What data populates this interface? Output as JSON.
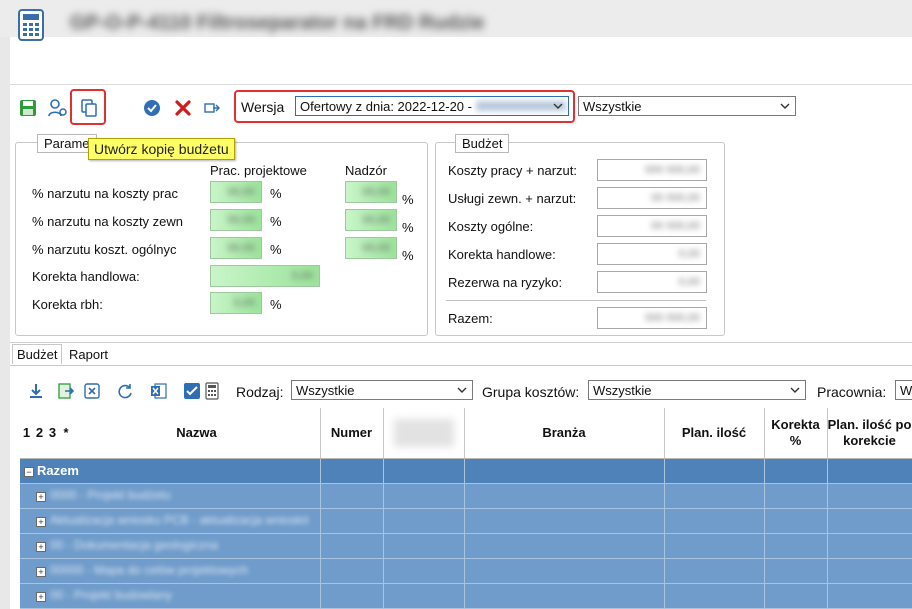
{
  "window": {
    "title": "GP-O-P-4110 Filtroseparator na FRD Rudzie"
  },
  "toolbar": {
    "version_label": "Wersja",
    "version_value": "Ofertowy z dnia: 2022-12-20 -",
    "scope_value": "Wszystkie",
    "tooltip": "Utwórz kopię budżetu"
  },
  "params": {
    "title": "Parame",
    "col_prac": "Prac. projektowe",
    "col_nadzor": "Nadzór",
    "rows": [
      {
        "label": "% narzutu na koszty prac",
        "v1": "00,00",
        "v2": "00,00",
        "pct": "%"
      },
      {
        "label": "% narzutu na koszty zewn",
        "v1": "00,00",
        "v2": "00,00",
        "pct": "%"
      },
      {
        "label": "% narzutu koszt. ogólnyc",
        "v1": "00,00",
        "v2": "00,00",
        "pct": "%"
      }
    ],
    "korekta_handlowa": "Korekta handlowa:",
    "korekta_handlowa_val": "0,00",
    "korekta_rbh": "Korekta rbh:",
    "korekta_rbh_val": "0,00",
    "pct": "%"
  },
  "budzet": {
    "title": "Budżet",
    "rows": [
      {
        "label": "Koszty pracy + narzut:",
        "value": "000 000,00"
      },
      {
        "label": "Usługi zewn. + narzut:",
        "value": "00 000,00"
      },
      {
        "label": "Koszty ogólne:",
        "value": "00 000,00"
      },
      {
        "label": "Korekta handlowe:",
        "value": "0,00"
      },
      {
        "label": "Rezerwa na ryzyko:",
        "value": "0,00"
      }
    ],
    "total_label": "Razem:",
    "total_value": "000 000,00"
  },
  "tabs": [
    "Budżet",
    "Raport"
  ],
  "filters": {
    "rodzaj_label": "Rodzaj:",
    "rodzaj_value": "Wszystkie",
    "grupa_label": "Grupa kosztów:",
    "grupa_value": "Wszystkie",
    "pracownia_label": "Pracownia:",
    "pracownia_value": "W"
  },
  "grid": {
    "columns": [
      "1",
      "2",
      "3",
      "*",
      "Nazwa",
      "Numer",
      "",
      "Branża",
      "Plan. ilość",
      "Korekta %",
      "Plan. ilość po korekcie"
    ],
    "rows": [
      {
        "name": "Razem",
        "type": "sum"
      },
      {
        "name": "0000 - Projekt budżetu",
        "type": "item"
      },
      {
        "name": "Aktualizacja wniosku PCB - aktualizacja wnioskó",
        "type": "item"
      },
      {
        "name": "00 - Dokumentacja geologiczna",
        "type": "item"
      },
      {
        "name": "00000 - Mapa do celów projektowych",
        "type": "item"
      },
      {
        "name": "00 - Projekt budowlany",
        "type": "item"
      }
    ]
  },
  "colors": {
    "highlight": "#e03030",
    "tooltip_bg": "#ffff66",
    "grid_row": "#6f9ccb",
    "grid_sum_row": "#4f82b8",
    "green_field": "#9be39b"
  }
}
